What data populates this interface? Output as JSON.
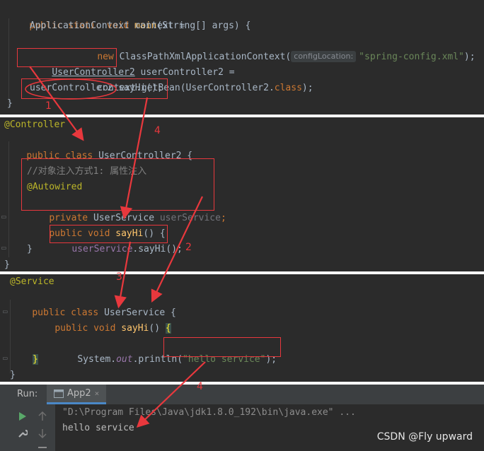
{
  "panel1": {
    "line1": {
      "kw1": "public",
      "kw2": "static",
      "kw3": "void",
      "fn": "main",
      "rest": "(String[] args) {"
    },
    "line2": "ApplicationContext context =",
    "line3": {
      "kw": "new",
      "cls": "ClassPathXmlApplicationContext(",
      "hint": "configLocation:",
      "str": "\"spring-config.xml\"",
      "end": ");"
    },
    "line4": {
      "link": "UserController2",
      "rest": " userController2 ="
    },
    "line5": {
      "pre": "context.getBean(UserController2.",
      "kw": "class",
      "end": ");"
    },
    "line6": "userController2.sayHi();",
    "line7": "}"
  },
  "panel2": {
    "line1": "@Controller",
    "line2": {
      "kw1": "public",
      "kw2": "class",
      "cls": "UserController2 {"
    },
    "comment": "//对象注入方式1: 属性注入",
    "autowired": "@Autowired",
    "field": {
      "kw": "private",
      "type": "UserService",
      "name": "userService",
      "end": ";"
    },
    "method": {
      "kw1": "public",
      "kw2": "void",
      "fn": "sayHi",
      "end": "() {"
    },
    "call": {
      "fld": "userService",
      "rest": ".sayHi();"
    },
    "close1": "}",
    "close2": "}"
  },
  "panel3": {
    "line1": "@Service",
    "line2": {
      "kw1": "public",
      "kw2": "class",
      "cls": "UserService {"
    },
    "method": {
      "kw1": "public",
      "kw2": "void",
      "fn": "sayHi",
      "paren": "() ",
      "brace": "{"
    },
    "print": {
      "pre": "System.",
      "out": "out",
      "mid": ".println(",
      "str": "\"hello service\"",
      "end": ");"
    },
    "close1": "}",
    "close2": "}"
  },
  "annotations": {
    "n1": "1",
    "n2": "2",
    "n3": "3",
    "n4a": "4",
    "n4b": "4"
  },
  "run": {
    "label": "Run:",
    "tab": "App2",
    "tab_close": "×",
    "cmd": "\"D:\\Program Files\\Java\\jdk1.8.0_192\\bin\\java.exe\" ...",
    "output": "hello service",
    "watermark": "CSDN @Fly upward"
  },
  "colors": {
    "red": "#e8383d",
    "editor_bg": "#2b2b2b",
    "keyword": "#cc7832",
    "function": "#ffc66d",
    "string": "#6a8759",
    "annotation": "#bbb529",
    "field": "#9876aa"
  }
}
